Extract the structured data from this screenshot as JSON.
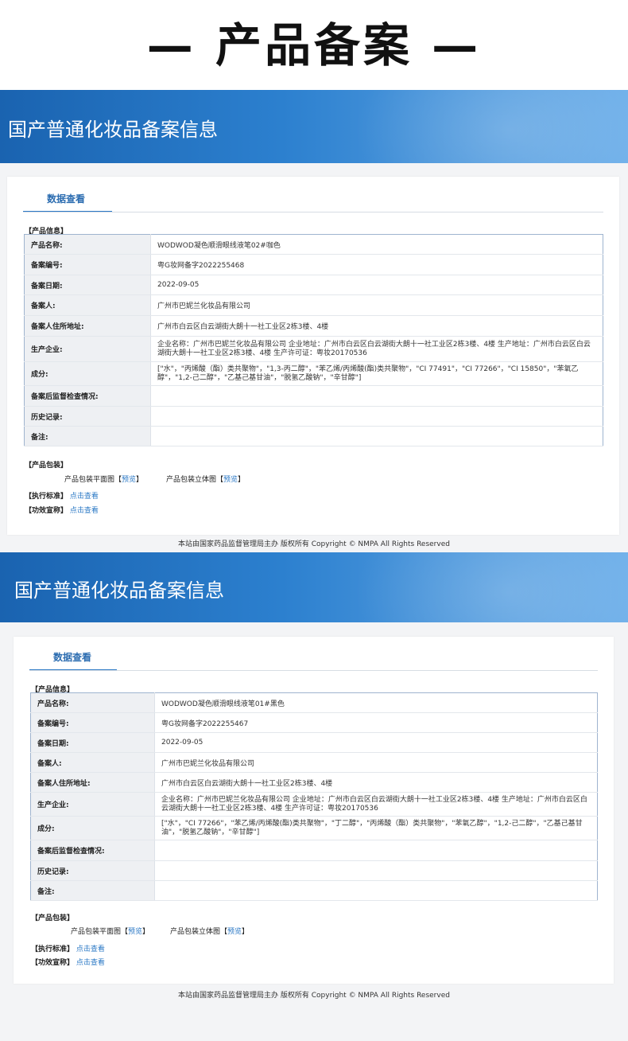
{
  "hero": {
    "title": "— 产品备案 —"
  },
  "labels": {
    "product_name": "产品名称:",
    "record_no": "备案编号:",
    "record_date": "备案日期:",
    "registrant": "备案人:",
    "registrant_address": "备案人住所地址:",
    "manufacturer": "生产企业:",
    "ingredients": "成分:",
    "post_supervision": "备案后监督检查情况:",
    "history": "历史记录:",
    "remarks": "备注:"
  },
  "records": [
    {
      "banner_title": "国产普通化妆品备案信息",
      "tab": "数据查看",
      "product_info_heading": "【产品信息】",
      "fields": {
        "product_name": "WODWOD凝色顺滑眼线液笔02#咖色",
        "record_no": "粤G妆网备字2022255468",
        "record_date": "2022-09-05",
        "registrant": "广州市巴妮兰化妆品有限公司",
        "registrant_address": "广州市白云区白云湖街大朗十一社工业区2栋3楼、4楼",
        "manufacturer": "企业名称：广州市巴妮兰化妆品有限公司 企业地址：广州市白云区白云湖街大朗十一社工业区2栋3楼、4楼 生产地址：广州市白云区白云湖街大朗十一社工业区2栋3楼、4楼 生产许可证：粤妆20170536",
        "ingredients": "[\"水\"，\"丙烯酸（酯）类共聚物\"，\"1,3-丙二醇\"，\"苯乙烯/丙烯酸(酯)类共聚物\"，\"CI 77491\"，\"CI 77266\"，\"CI 15850\"，\"苯氧乙醇\"，\"1,2-己二醇\"，\"乙基己基甘油\"，\"脱氢乙酸钠\"，\"辛甘醇\"]",
        "post_supervision": "",
        "history": "",
        "remarks": ""
      },
      "packaging_heading": "【产品包装】",
      "packaging_flat_label": "产品包装平面图",
      "packaging_3d_label": "产品包装立体图",
      "preview_open": "【",
      "preview_link": "预览",
      "preview_close": "】",
      "standard_heading": "【执行标准】",
      "standard_link": "点击查看",
      "efficacy_heading": "【功效宣称】",
      "efficacy_link": "点击查看",
      "footer": "本站由国家药品监督管理局主办 版权所有 Copyright © NMPA All Rights Reserved"
    },
    {
      "banner_title": "国产普通化妆品备案信息",
      "tab": "数据查看",
      "product_info_heading": "【产品信息】",
      "fields": {
        "product_name": "WODWOD凝色顺滑眼线液笔01#黑色",
        "record_no": "粤G妆网备字2022255467",
        "record_date": "2022-09-05",
        "registrant": "广州市巴妮兰化妆品有限公司",
        "registrant_address": "广州市白云区白云湖街大朗十一社工业区2栋3楼、4楼",
        "manufacturer": "企业名称：广州市巴妮兰化妆品有限公司 企业地址：广州市白云区白云湖街大朗十一社工业区2栋3楼、4楼 生产地址：广州市白云区白云湖街大朗十一社工业区2栋3楼、4楼 生产许可证：粤妆20170536",
        "ingredients": "[\"水\"，\"CI 77266\"，\"苯乙烯/丙烯酸(酯)类共聚物\"，\"丁二醇\"，\"丙烯酸（酯）类共聚物\"，\"苯氧乙醇\"，\"1,2-己二醇\"，\"乙基己基甘油\"，\"脱氢乙酸钠\"，\"辛甘醇\"]",
        "post_supervision": "",
        "history": "",
        "remarks": ""
      },
      "packaging_heading": "【产品包装】",
      "packaging_flat_label": "产品包装平面图",
      "packaging_3d_label": "产品包装立体图",
      "preview_open": "【",
      "preview_link": "预览",
      "preview_close": "】",
      "standard_heading": "【执行标准】",
      "standard_link": "点击查看",
      "efficacy_heading": "【功效宣称】",
      "efficacy_link": "点击查看",
      "footer": "本站由国家药品监督管理局主办 版权所有 Copyright © NMPA All Rights Reserved"
    }
  ]
}
